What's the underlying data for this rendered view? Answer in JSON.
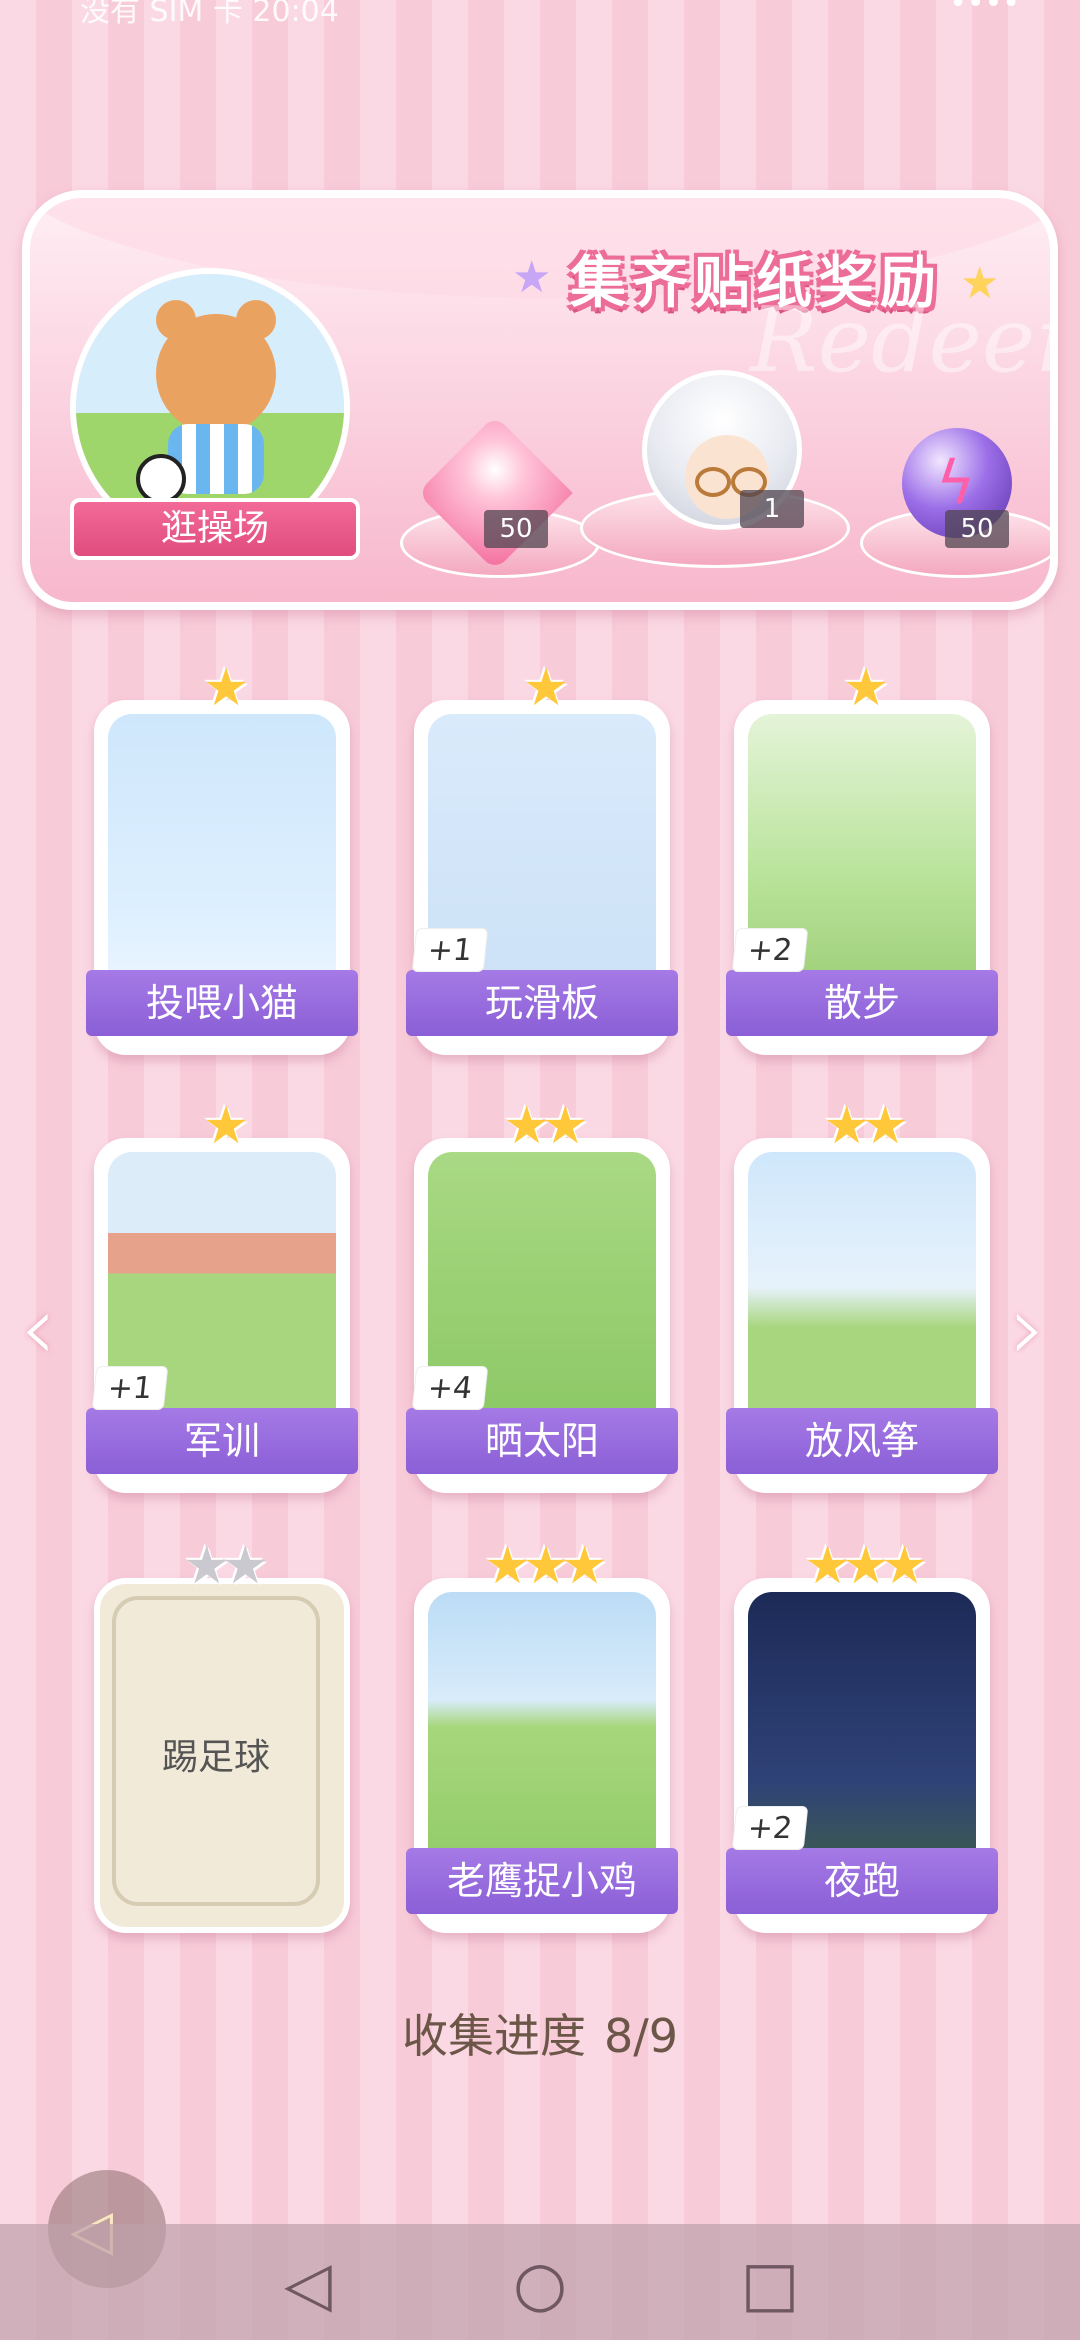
{
  "status_bar": {
    "left_text": "没有 SIM 卡 20:04",
    "right_text": "••••"
  },
  "reward_panel": {
    "title": "集齐贴纸奖励",
    "watermark": "Redeem",
    "playground_button": "逛操场",
    "rewards": [
      {
        "name": "heart-gem",
        "qty": "50"
      },
      {
        "name": "character-portrait",
        "qty": "1"
      },
      {
        "name": "energy-orb",
        "qty": "50"
      }
    ]
  },
  "stickers": [
    {
      "label": "投喂小猫",
      "stars": 1,
      "count": "",
      "scene": "cat"
    },
    {
      "label": "玩滑板",
      "stars": 1,
      "count": "+1",
      "scene": "skate"
    },
    {
      "label": "散步",
      "stars": 1,
      "count": "+2",
      "scene": "walk"
    },
    {
      "label": "军训",
      "stars": 1,
      "count": "+1",
      "scene": "army"
    },
    {
      "label": "晒太阳",
      "stars": 2,
      "count": "+4",
      "scene": "sun"
    },
    {
      "label": "放风筝",
      "stars": 2,
      "count": "",
      "scene": "kite"
    },
    {
      "label": "踢足球",
      "stars": 2,
      "count": "",
      "scene": "locked",
      "locked": true
    },
    {
      "label": "老鹰捉小鸡",
      "stars": 3,
      "count": "",
      "scene": "eagle"
    },
    {
      "label": "夜跑",
      "stars": 3,
      "count": "+2",
      "scene": "night"
    }
  ],
  "progress": {
    "label": "收集进度",
    "value": "8/9",
    "fraction": 0.889
  },
  "nav": {
    "back_icon": "triangle-back-icon",
    "home_icon": "circle-home-icon",
    "recent_icon": "square-recent-icon"
  },
  "colors": {
    "accent_pink": "#e04c7e",
    "label_purple": "#8b5fd6",
    "star_gold": "#ffc83a"
  }
}
